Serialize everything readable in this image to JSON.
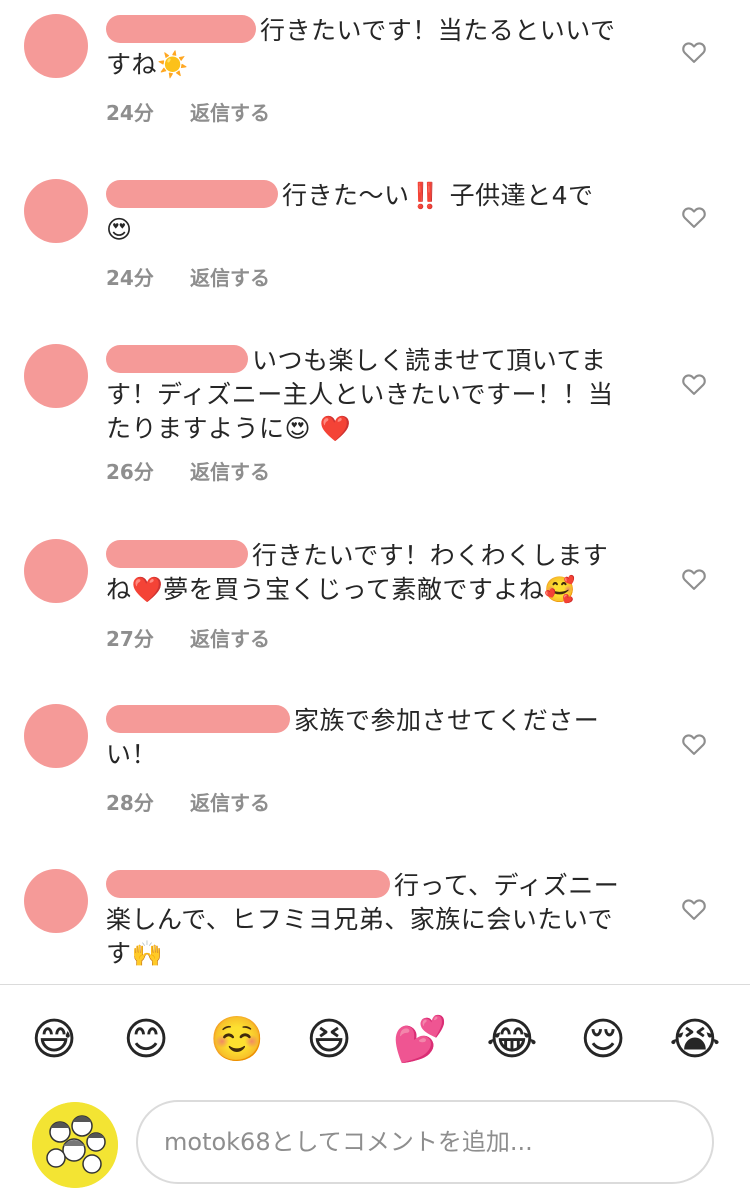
{
  "comments": [
    {
      "text": "行きたいです！当たるといいですね",
      "emojis": "☀️",
      "time": "24分",
      "reply": "返信する"
    },
    {
      "text": "行きた〜い‼️ 子供達と4で",
      "emojis": "😍",
      "time": "24分",
      "reply": "返信する"
    },
    {
      "text": "いつも楽しく読ませて頂いてます！ディズニー主人といきたいですー！！当たりますように",
      "emojis": "😍 ❤️",
      "time": "26分",
      "reply": "返信する"
    },
    {
      "text_a": "行きたいです！わくわくしますね",
      "emoji_a": "❤️",
      "text_b": "夢を買う宝くじって素敵ですよね",
      "emoji_b": "🥰",
      "time": "27分",
      "reply": "返信する"
    },
    {
      "text": "家族で参加させてくださーい！",
      "time": "28分",
      "reply": "返信する"
    },
    {
      "text": "行って、ディズニー楽しんで、ヒフミヨ兄弟、家族に会いたいです",
      "emojis": "🙌"
    }
  ],
  "quick_emojis": [
    "😅",
    "😊",
    "☺️",
    "😆",
    "💕",
    "😂",
    "😌",
    "😭"
  ],
  "composer": {
    "placeholder": "motok68としてコメントを追加..."
  },
  "colors": {
    "redaction": "#f59a98",
    "meta_gray": "#8e8e8e",
    "my_avatar_bg": "#f3e433"
  },
  "icons": {
    "like": "heart-outline-icon"
  }
}
